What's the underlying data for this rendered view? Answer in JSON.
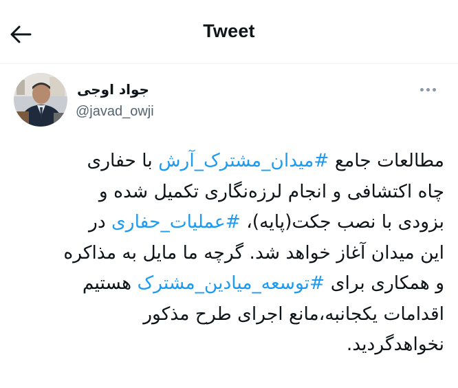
{
  "header": {
    "title": "Tweet",
    "back_icon": "arrow-left-icon"
  },
  "author": {
    "display_name": "جواد اوجی",
    "handle": "@javad_owji",
    "avatar_icon": "profile-photo"
  },
  "more_icon": "more-horizontal-icon",
  "tweet": {
    "lines": [
      [
        {
          "text": "مطالعات جامع ",
          "hashtag": false
        },
        {
          "text": "#میدان_مشترک_آرش",
          "hashtag": true
        },
        {
          "text": " با حفاری",
          "hashtag": false
        }
      ],
      [
        {
          "text": "چاه اکتشافی و انجام لرزه‌نگاری تکمیل شده و",
          "hashtag": false
        }
      ],
      [
        {
          "text": "بزودی با نصب جکت(پایه)، ",
          "hashtag": false
        },
        {
          "text": "#عملیات_حفاری",
          "hashtag": true
        },
        {
          "text": " در",
          "hashtag": false
        }
      ],
      [
        {
          "text": "این میدان آغاز خواهد شد. گرچه ما مایل به مذاکره",
          "hashtag": false
        }
      ],
      [
        {
          "text": "و همکاری برای ",
          "hashtag": false
        },
        {
          "text": "#توسعه_میادین_مشترک",
          "hashtag": true
        },
        {
          "text": " هستیم",
          "hashtag": false
        }
      ],
      [
        {
          "text": "اقدامات یکجانبه،مانع اجرای طرح مذکور",
          "hashtag": false
        }
      ],
      [
        {
          "text": "نخواهدگردید.",
          "hashtag": false
        }
      ]
    ]
  },
  "colors": {
    "text": "#0f1419",
    "secondary": "#536471",
    "link": "#1d9bf0",
    "divider": "#eff3f4"
  }
}
